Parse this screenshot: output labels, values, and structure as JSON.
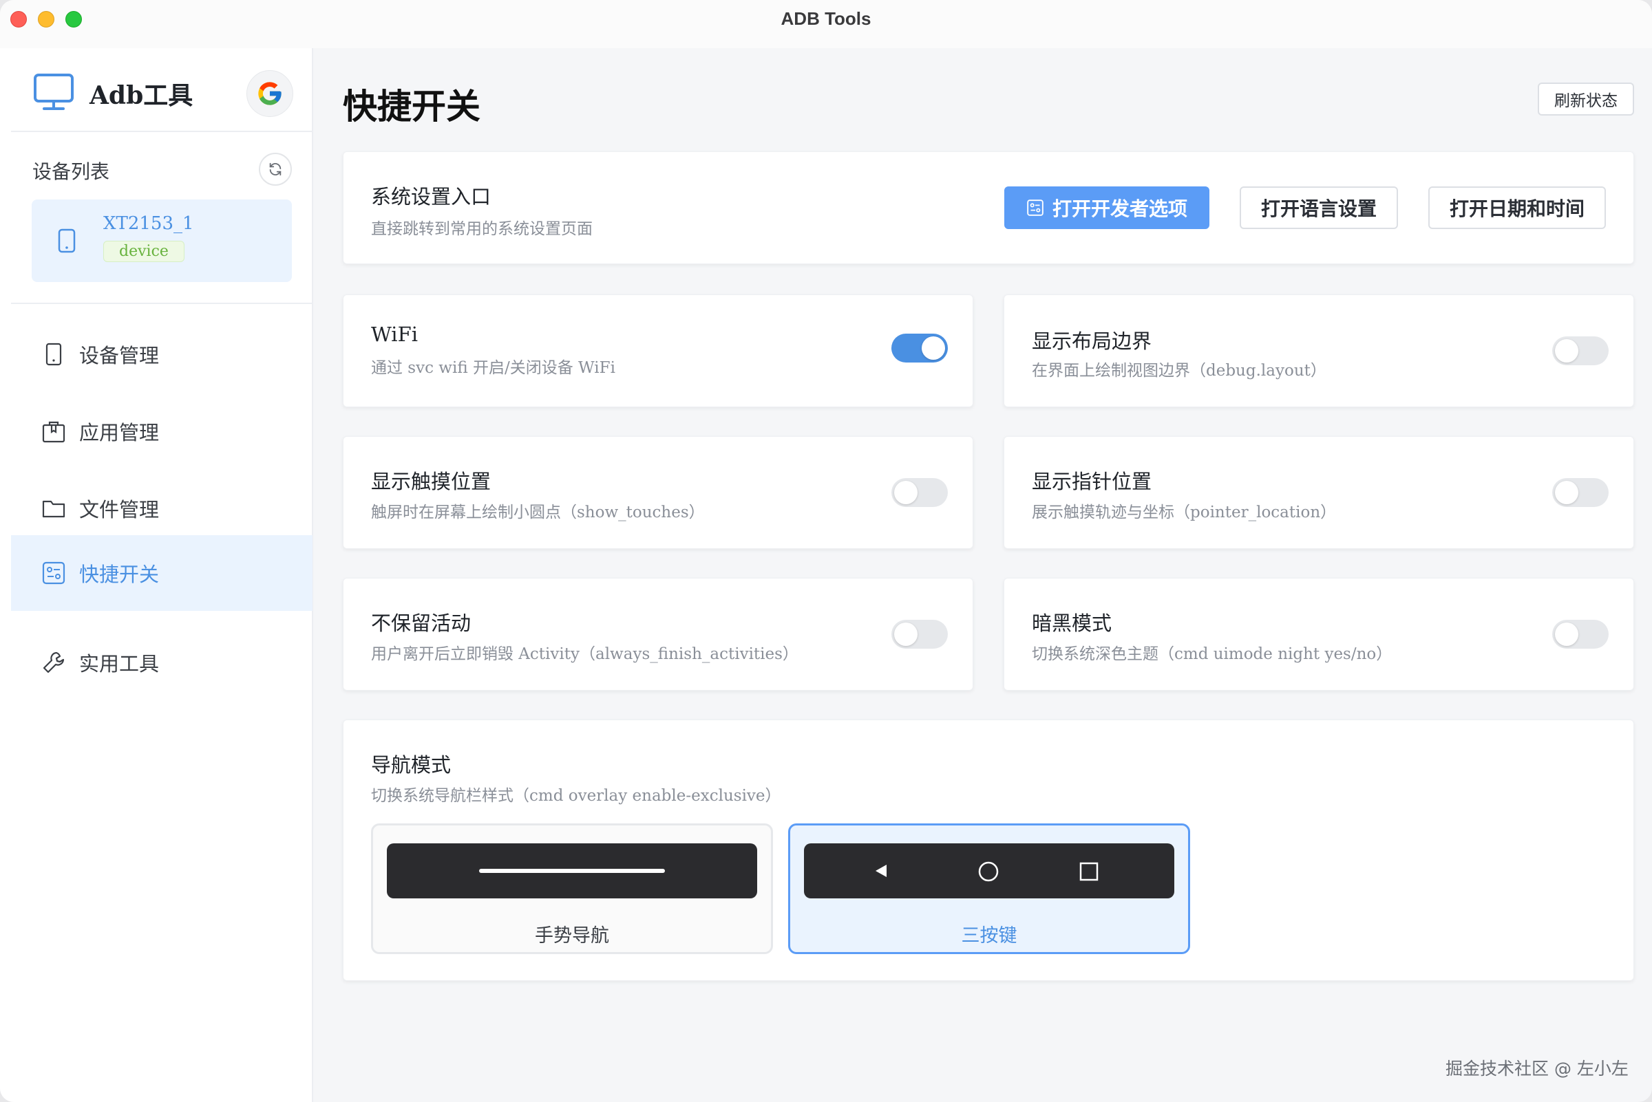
{
  "window": {
    "title": "ADB Tools"
  },
  "sidebar": {
    "brand": "Adb工具",
    "device_list_label": "设备列表",
    "device": {
      "name": "XT2153_1",
      "status": "device"
    },
    "nav_items": [
      {
        "label": "设备管理",
        "icon": "tablet-icon"
      },
      {
        "label": "应用管理",
        "icon": "package-icon"
      },
      {
        "label": "文件管理",
        "icon": "folder-icon"
      },
      {
        "label": "快捷开关",
        "icon": "switch-panel-icon",
        "active": true
      },
      {
        "label": "实用工具",
        "icon": "wrench-icon"
      }
    ]
  },
  "main": {
    "title": "快捷开关",
    "refresh_label": "刷新状态",
    "system_settings": {
      "title": "系统设置入口",
      "desc": "直接跳转到常用的系统设置页面",
      "buttons": [
        "打开开发者选项",
        "打开语言设置",
        "打开日期和时间"
      ]
    },
    "toggles": [
      {
        "title": "WiFi",
        "desc": "通过 svc wifi 开启/关闭设备 WiFi",
        "on": true
      },
      {
        "title": "显示布局边界",
        "desc": "在界面上绘制视图边界（debug.layout）",
        "on": false
      },
      {
        "title": "显示触摸位置",
        "desc": "触屏时在屏幕上绘制小圆点（show_touches）",
        "on": false
      },
      {
        "title": "显示指针位置",
        "desc": "展示触摸轨迹与坐标（pointer_location）",
        "on": false
      },
      {
        "title": "不保留活动",
        "desc": "用户离开后立即销毁 Activity（always_finish_activities）",
        "on": false
      },
      {
        "title": "暗黑模式",
        "desc": "切换系统深色主题（cmd uimode night yes/no）",
        "on": false
      }
    ],
    "navigation": {
      "title": "导航模式",
      "desc": "切换系统导航栏样式（cmd overlay enable-exclusive）",
      "options": [
        {
          "label": "手势导航",
          "selected": false
        },
        {
          "label": "三按键",
          "selected": true
        }
      ]
    }
  },
  "watermark": "掘金技术社区 @ 左小左",
  "colors": {
    "accent": "#4a90e2",
    "primary_button": "#5b9cf6",
    "badge_green": "#67b23d"
  }
}
